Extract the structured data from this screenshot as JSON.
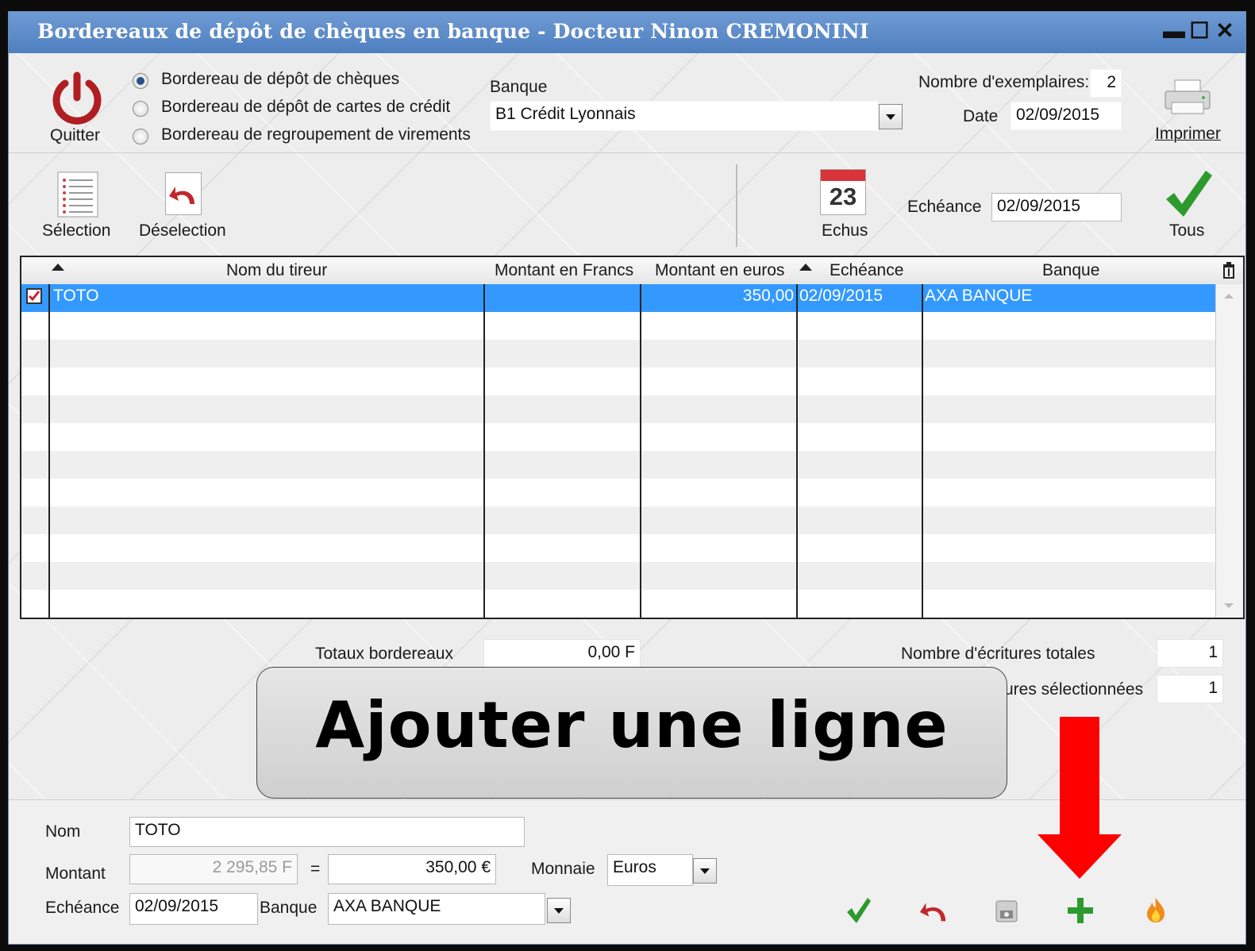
{
  "window": {
    "title": "Bordereaux de dépôt de chèques en banque - Docteur Ninon CREMONINI",
    "btn_minimize": "▬",
    "btn_maximize": "☐",
    "btn_close": "✕"
  },
  "top": {
    "quit_label": "Quitter",
    "radios": [
      {
        "label": "Bordereau de dépôt de chèques",
        "selected": true
      },
      {
        "label": "Bordereau de dépôt de cartes de crédit",
        "selected": false
      },
      {
        "label": "Bordereau de regroupement de virements",
        "selected": false
      }
    ],
    "bank_label": "Banque",
    "bank_value": "B1 Crédit Lyonnais",
    "copies_label": "Nombre d'exemplaires:",
    "copies_value": "2",
    "date_label": "Date",
    "date_value": "02/09/2015",
    "print_label": "Imprimer"
  },
  "toolbar": {
    "selection_label": "Sélection",
    "deselection_label": "Déselection",
    "echus_label": "Echus",
    "calendar_day": "23",
    "echeance_label": "Echéance",
    "echeance_value": "02/09/2015",
    "tous_label": "Tous"
  },
  "table": {
    "headers": [
      "Nom du tireur",
      "Montant en Francs",
      "Montant en euros",
      "Echéance",
      "Banque"
    ],
    "rows": [
      {
        "checked": true,
        "nom": "TOTO",
        "francs": "",
        "euros": "350,00",
        "echeance": "02/09/2015",
        "banque": "AXA BANQUE"
      }
    ]
  },
  "totals": {
    "totaux_label": "Totaux bordereaux",
    "totaux_value": "0,00 F",
    "nb_total_label": "Nombre d'écritures totales",
    "nb_total_value": "1",
    "nb_sel_label": "ures sélectionnées",
    "nb_sel_value": "1"
  },
  "overlay": {
    "text": "Ajouter une ligne",
    "arrow_color": "#ff0000"
  },
  "form": {
    "nom_label": "Nom",
    "nom_value": "TOTO",
    "montant_label": "Montant",
    "montant_francs": "2 295,85 F",
    "equals": "=",
    "montant_euros": "350,00 €",
    "monnaie_label": "Monnaie",
    "monnaie_value": "Euros",
    "echeance_label": "Echéance",
    "echeance_value": "02/09/2015",
    "banque_label": "Banque",
    "banque_value": "AXA BANQUE"
  },
  "colors": {
    "titlebar": "#4f7fc0",
    "selection": "#3399ff",
    "validate_green": "#2e9a2e",
    "undo_red": "#c0282d",
    "add_green": "#2e9a2e",
    "fire_orange": "#f08a1a"
  }
}
